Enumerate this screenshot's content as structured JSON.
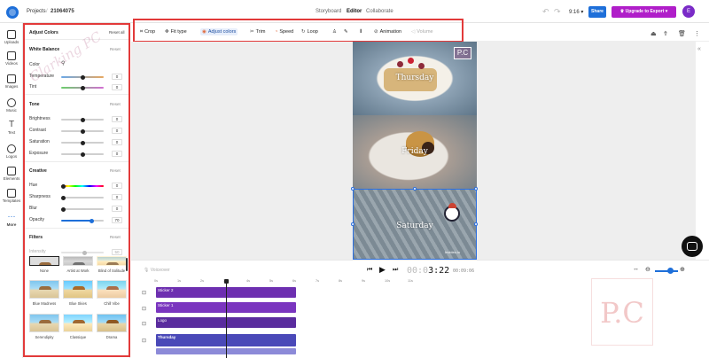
{
  "topbar": {
    "breadcrumb_parent": "Projects",
    "breadcrumb_sep": "/",
    "project_name": "21064075",
    "tabs": [
      {
        "label": "Storyboard"
      },
      {
        "label": "Editor"
      },
      {
        "label": "Collaborate"
      }
    ],
    "time_selector": "9:16",
    "share_label": "Share",
    "upgrade_label": "Upgrade to Export",
    "avatar_initial": "E"
  },
  "rail": {
    "items": [
      {
        "label": "Uploads",
        "icon": "upload-icon"
      },
      {
        "label": "Videos",
        "icon": "video-icon"
      },
      {
        "label": "Images",
        "icon": "image-icon"
      },
      {
        "label": "Music",
        "icon": "music-icon"
      },
      {
        "label": "Text",
        "icon": "text-icon"
      },
      {
        "label": "Logos",
        "icon": "logo-icon"
      },
      {
        "label": "Elements",
        "icon": "elements-icon"
      },
      {
        "label": "Templates",
        "icon": "templates-icon"
      },
      {
        "label": "More",
        "icon": "more-icon"
      }
    ]
  },
  "panel": {
    "title": "Adjust Colors",
    "reset_all": "Reset all",
    "white_balance": {
      "heading": "White Balance",
      "reset": "Reset",
      "color_label": "Color",
      "temperature_label": "Temperature",
      "temperature_value": "0",
      "tint_label": "Tint",
      "tint_value": "0"
    },
    "tone": {
      "heading": "Tone",
      "reset": "Reset",
      "brightness_label": "Brightness",
      "brightness_value": "0",
      "contrast_label": "Contrast",
      "contrast_value": "0",
      "saturation_label": "Saturation",
      "saturation_value": "0",
      "exposure_label": "Exposure",
      "exposure_value": "0"
    },
    "creative": {
      "heading": "Creative",
      "reset": "Reset",
      "hue_label": "Hue",
      "hue_value": "0",
      "sharpness_label": "Sharpness",
      "sharpness_value": "0",
      "blur_label": "Blur",
      "blur_value": "0",
      "opacity_label": "Opacity",
      "opacity_value": "70"
    },
    "filters": {
      "heading": "Filters",
      "reset": "Reset",
      "intensity_label": "Intensity",
      "intensity_value": "50",
      "items": [
        {
          "label": "None"
        },
        {
          "label": "Artist at Work"
        },
        {
          "label": "Blind of Solitude"
        },
        {
          "label": "Blue Madness"
        },
        {
          "label": "Blue Skies"
        },
        {
          "label": "Chill Vibe"
        },
        {
          "label": "Serendipity"
        },
        {
          "label": "Classique"
        },
        {
          "label": "Drama"
        }
      ]
    }
  },
  "toolbar": {
    "crop": "Crop",
    "fit_type": "Fit type",
    "adjust_colors": "Adjust colors",
    "trim": "Trim",
    "speed": "Speed",
    "loop": "Loop",
    "animation": "Animation",
    "volume": "Volume"
  },
  "canvas": {
    "frames": [
      {
        "word": "Thursday"
      },
      {
        "word": "Friday"
      },
      {
        "word": "Saturday"
      }
    ],
    "pc_mark": "P.C",
    "small_watermark": "Invideo.io"
  },
  "watermark_text": "Clarking PC",
  "playback": {
    "voiceover_label": "Voiceover",
    "current_time_dim": "00:0",
    "current_time": "3:22",
    "total_time": "00:09:06"
  },
  "timeline": {
    "ruler": [
      "0s",
      "1s",
      "2s",
      "3s",
      "4s",
      "5s",
      "6s",
      "7s",
      "8s",
      "9s",
      "10s",
      "11s"
    ],
    "tracks": [
      {
        "label": "Sticker 2"
      },
      {
        "label": "Sticker 1"
      },
      {
        "label": "Logo"
      },
      {
        "label": "Thursday"
      }
    ]
  },
  "brand_mark": "P.C"
}
